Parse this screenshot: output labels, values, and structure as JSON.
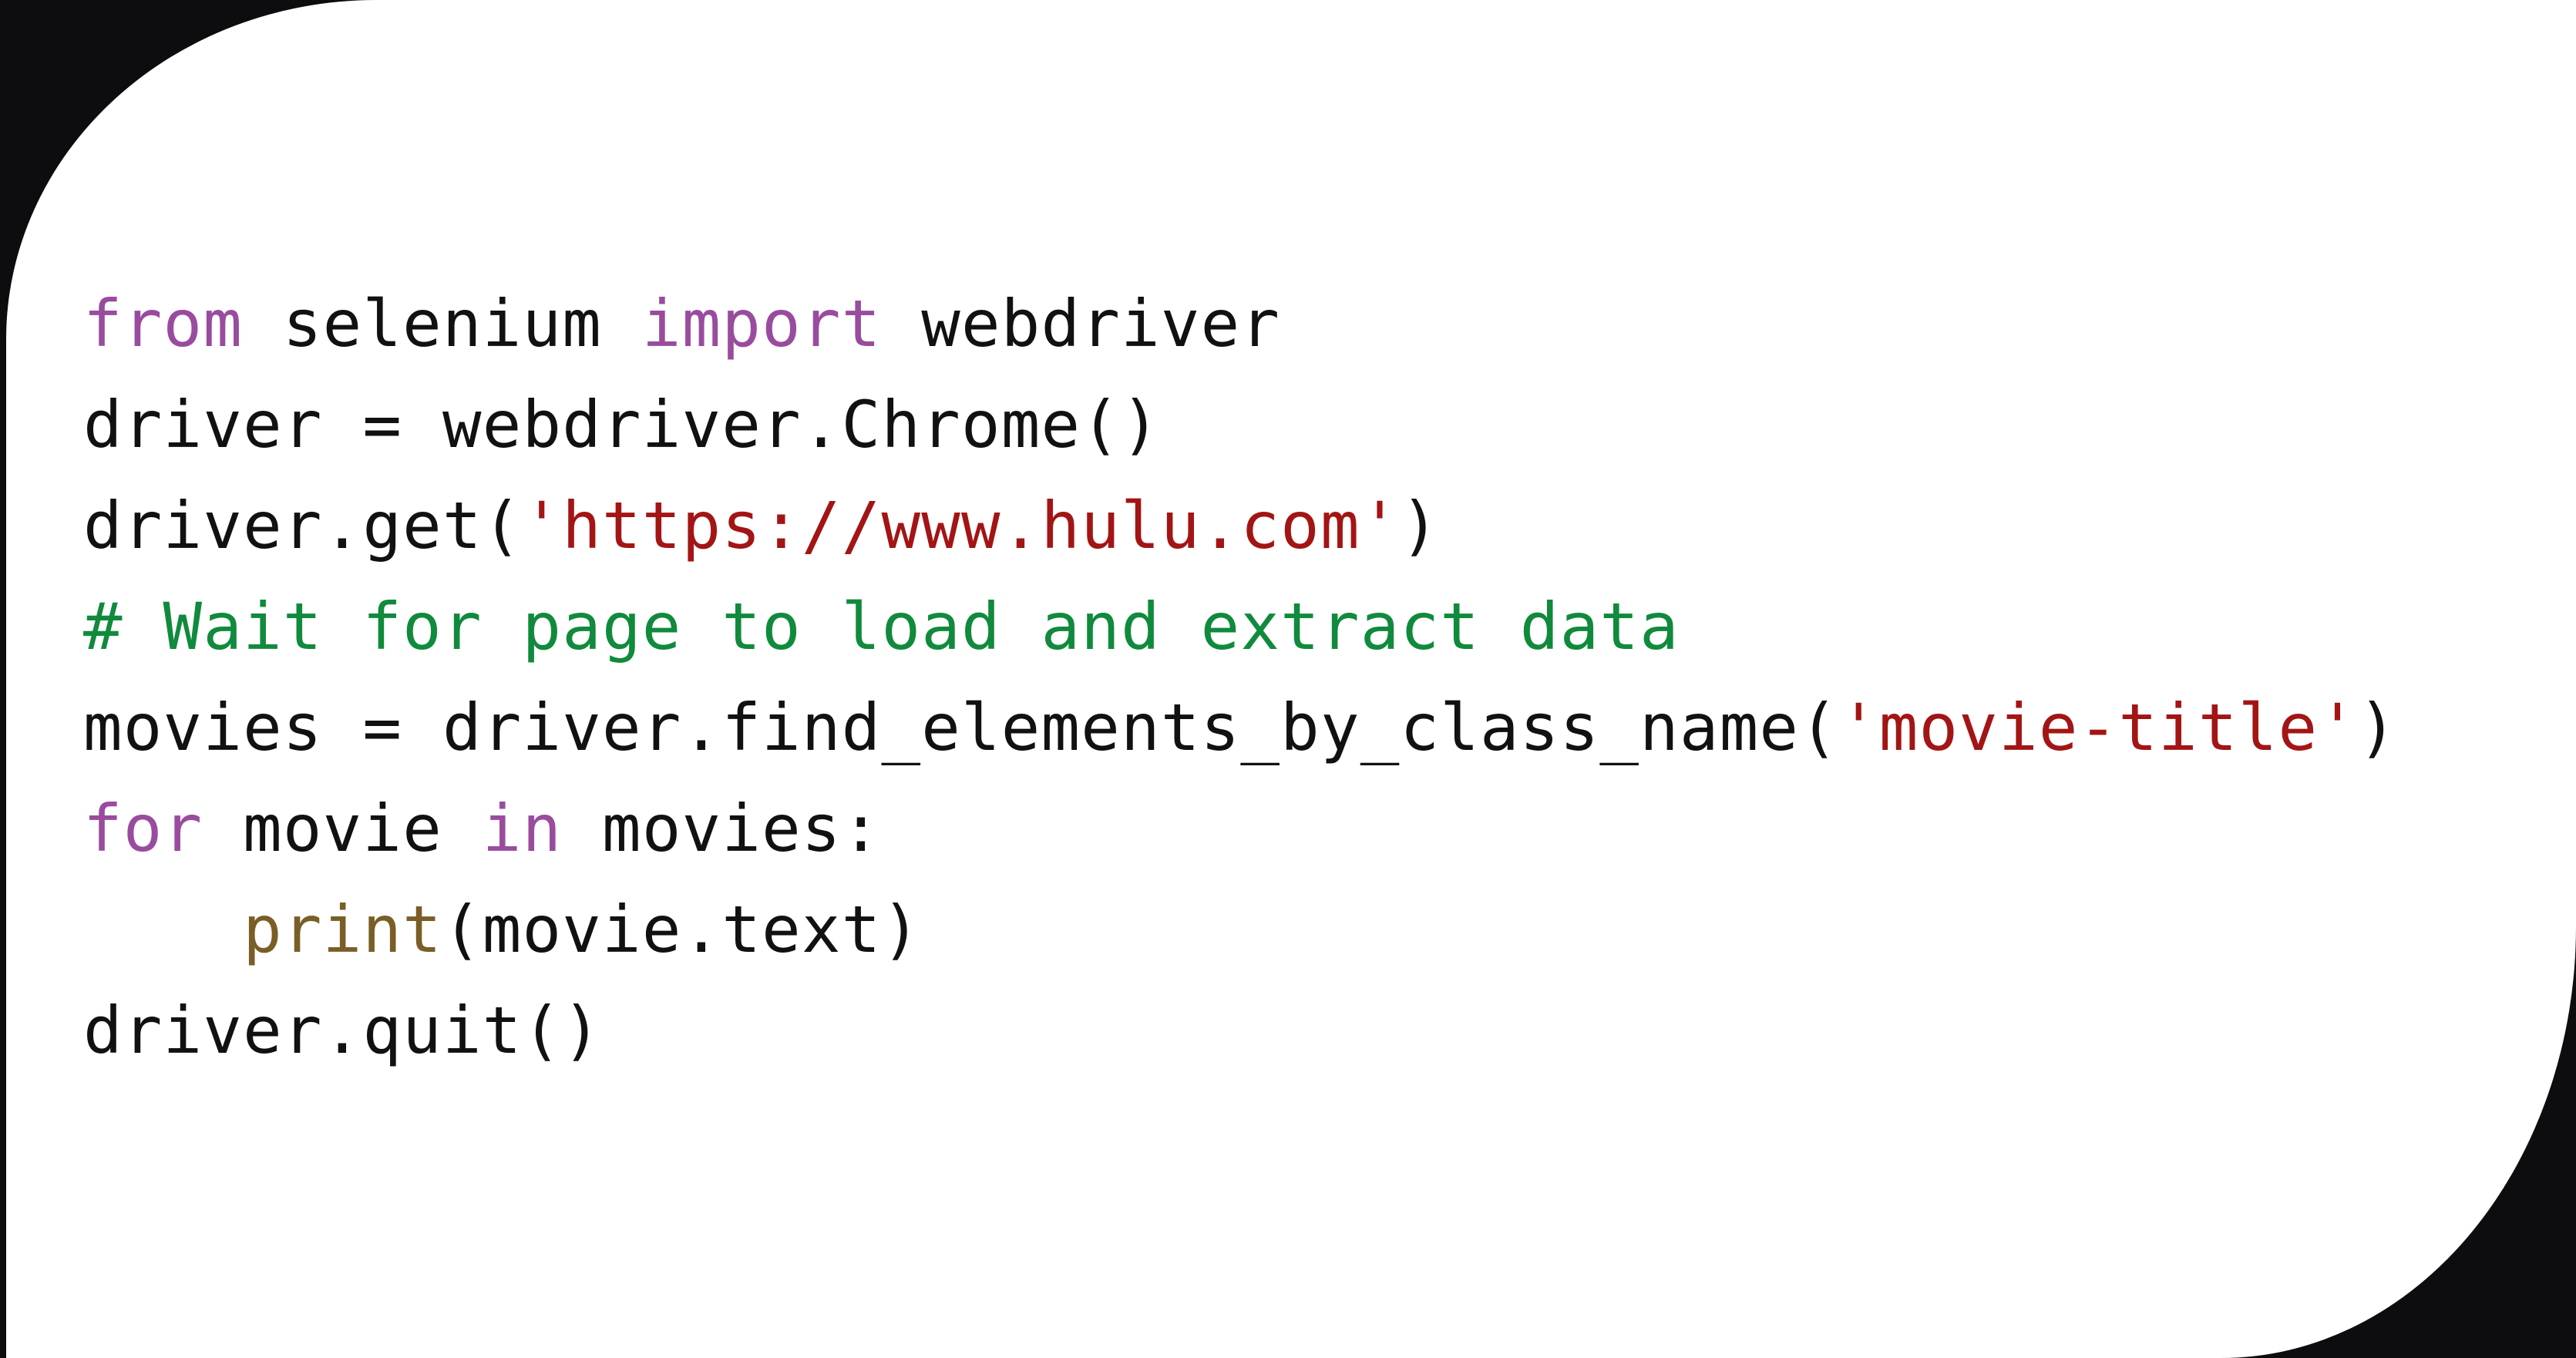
{
  "code_snippet": {
    "language": "python",
    "colors": {
      "keyword": "#994c9e",
      "string": "#a31515",
      "comment": "#108a3c",
      "builtin": "#795e26",
      "text": "#111111",
      "background": "#ffffff",
      "frame": "#0d0d0f"
    },
    "lines": [
      {
        "tokens": [
          {
            "t": "from",
            "c": "kw"
          },
          {
            "t": " selenium ",
            "c": ""
          },
          {
            "t": "import",
            "c": "kw"
          },
          {
            "t": " webdriver",
            "c": ""
          }
        ]
      },
      {
        "tokens": [
          {
            "t": "driver = webdriver.Chrome()",
            "c": ""
          }
        ]
      },
      {
        "tokens": [
          {
            "t": "driver.get(",
            "c": ""
          },
          {
            "t": "'https://www.hulu.com'",
            "c": "str"
          },
          {
            "t": ")",
            "c": ""
          }
        ]
      },
      {
        "tokens": [
          {
            "t": "# Wait for page to load and extract data",
            "c": "cm"
          }
        ]
      },
      {
        "tokens": [
          {
            "t": "movies = driver.find_elements_by_class_name(",
            "c": ""
          },
          {
            "t": "'movie-title'",
            "c": "str"
          },
          {
            "t": ")",
            "c": ""
          }
        ]
      },
      {
        "tokens": [
          {
            "t": "for",
            "c": "kw"
          },
          {
            "t": " movie ",
            "c": ""
          },
          {
            "t": "in",
            "c": "kw"
          },
          {
            "t": " movies:",
            "c": ""
          }
        ]
      },
      {
        "tokens": [
          {
            "t": "    ",
            "c": ""
          },
          {
            "t": "print",
            "c": "fn"
          },
          {
            "t": "(movie.text)",
            "c": ""
          }
        ]
      },
      {
        "tokens": [
          {
            "t": "driver.quit()",
            "c": ""
          }
        ]
      }
    ]
  }
}
